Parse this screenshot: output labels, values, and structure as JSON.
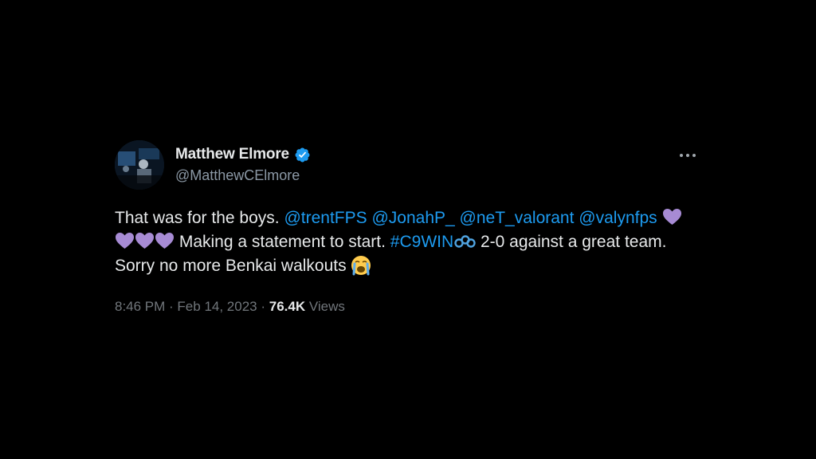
{
  "author": {
    "display_name": "Matthew Elmore",
    "handle": "@MatthewCElmore",
    "verified_icon": "verified-badge-icon",
    "avatar_icon": "profile-avatar"
  },
  "colors": {
    "background": "#000000",
    "text": "#e7e9ea",
    "secondary": "#71767b",
    "link": "#1d9bf0",
    "heart": "#a78bd4"
  },
  "tweet": {
    "text_1": "That was for the boys. ",
    "mention_1": "@trentFPS",
    "mention_2": "@JonahP_",
    "mention_3": "@neT_valorant",
    "mention_4": "@valynfps",
    "text_2": " Making a statement to start. ",
    "hashtag": "#C9WIN",
    "text_3": " 2-0 against a great team. Sorry no more Benkai walkouts ",
    "emoji": [
      "purple-heart-icon",
      "purple-heart-icon",
      "purple-heart-icon",
      "purple-heart-icon",
      "cloud9-icon",
      "loudly-crying-face-icon"
    ]
  },
  "meta": {
    "time": "8:46 PM",
    "separator": " · ",
    "date": "Feb 14, 2023",
    "separator_2": " · ",
    "views_count": "76.4K",
    "views_label": " Views"
  },
  "menu": {
    "more_icon": "more-options-icon"
  }
}
